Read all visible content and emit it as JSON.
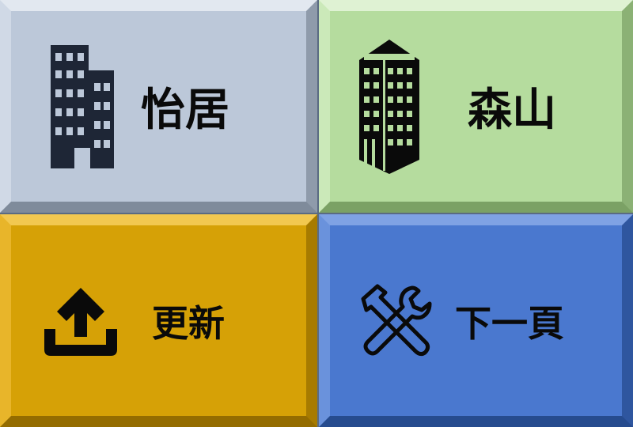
{
  "tiles": [
    {
      "label": "怡居",
      "icon": "office-building-icon",
      "color": "#bcc8d9"
    },
    {
      "label": "森山",
      "icon": "tower-building-icon",
      "color": "#b5dc9e"
    },
    {
      "label": "更新",
      "icon": "upload-icon",
      "color": "#d6a106"
    },
    {
      "label": "下一頁",
      "icon": "tools-icon",
      "color": "#4a78cf"
    }
  ]
}
